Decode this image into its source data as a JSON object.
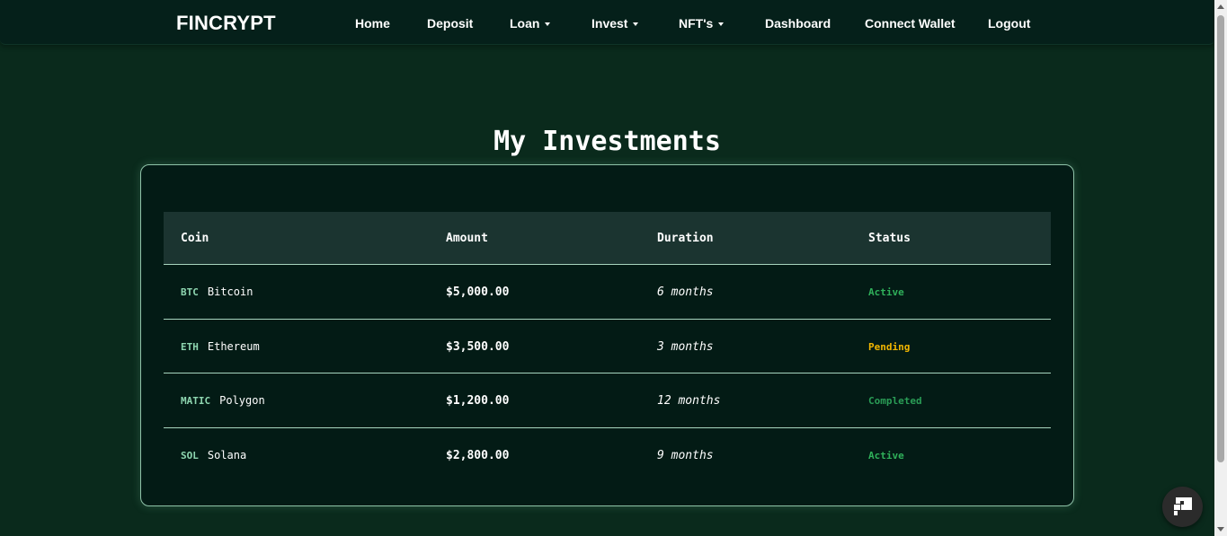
{
  "nav": {
    "brand": "FINCRYPT",
    "items": [
      {
        "label": "Home",
        "has_caret": false
      },
      {
        "label": "Deposit",
        "has_caret": false
      },
      {
        "label": "Loan",
        "has_caret": true
      },
      {
        "label": "Invest",
        "has_caret": true
      },
      {
        "label": "NFT's",
        "has_caret": true
      },
      {
        "label": "Dashboard",
        "has_caret": false
      },
      {
        "label": "Connect Wallet",
        "has_caret": false
      },
      {
        "label": "Logout",
        "has_caret": false
      }
    ]
  },
  "main": {
    "title": "My Investments",
    "table": {
      "headers": [
        "Coin",
        "Amount",
        "Duration",
        "Status"
      ],
      "rows": [
        {
          "symbol": "BTC",
          "name": "Bitcoin",
          "amount": "$5,000.00",
          "duration": "6 months",
          "status": "Active",
          "status_color": "#2fb05a"
        },
        {
          "symbol": "ETH",
          "name": "Ethereum",
          "amount": "$3,500.00",
          "duration": "3 months",
          "status": "Pending",
          "status_color": "#f2b600"
        },
        {
          "symbol": "MATIC",
          "name": "Polygon",
          "amount": "$1,200.00",
          "duration": "12 months",
          "status": "Completed",
          "status_color": "#2a9d56"
        },
        {
          "symbol": "SOL",
          "name": "Solana",
          "amount": "$2,800.00",
          "duration": "9 months",
          "status": "Active",
          "status_color": "#2fb05a"
        }
      ]
    }
  },
  "colors": {
    "background": "#0a2a1c",
    "card": "#031b15",
    "header_row": "#1b3430",
    "accent": "#8ed6b0"
  },
  "icons": {
    "chat": "chat-widget-icon",
    "dropdown": "chevron-down-icon"
  }
}
